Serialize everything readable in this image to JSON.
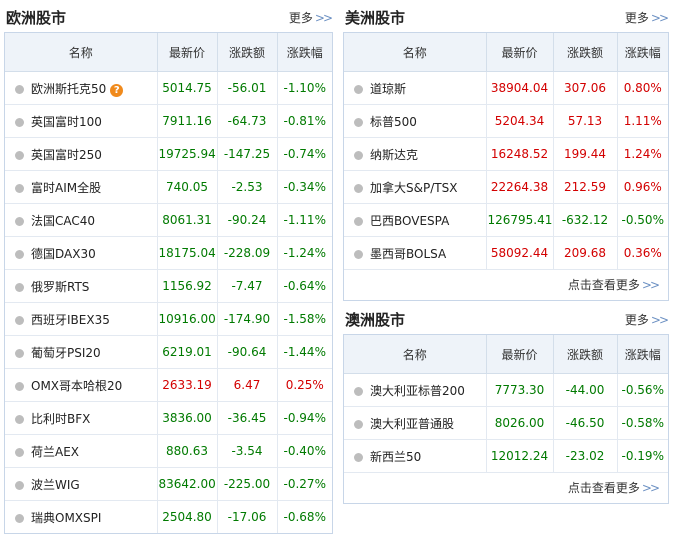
{
  "europe": {
    "title": "欧洲股市",
    "more": "更多",
    "headers": [
      "名称",
      "最新价",
      "涨跌额",
      "涨跌幅"
    ],
    "rows": [
      {
        "name": "欧洲斯托克50",
        "price": "5014.75",
        "change": "-56.01",
        "pct": "-1.10%",
        "dir": "down",
        "hint": "?"
      },
      {
        "name": "英国富时100",
        "price": "7911.16",
        "change": "-64.73",
        "pct": "-0.81%",
        "dir": "down"
      },
      {
        "name": "英国富时250",
        "price": "19725.94",
        "change": "-147.25",
        "pct": "-0.74%",
        "dir": "down"
      },
      {
        "name": "富时AIM全股",
        "price": "740.05",
        "change": "-2.53",
        "pct": "-0.34%",
        "dir": "down"
      },
      {
        "name": "法国CAC40",
        "price": "8061.31",
        "change": "-90.24",
        "pct": "-1.11%",
        "dir": "down"
      },
      {
        "name": "德国DAX30",
        "price": "18175.04",
        "change": "-228.09",
        "pct": "-1.24%",
        "dir": "down"
      },
      {
        "name": "俄罗斯RTS",
        "price": "1156.92",
        "change": "-7.47",
        "pct": "-0.64%",
        "dir": "down"
      },
      {
        "name": "西班牙IBEX35",
        "price": "10916.00",
        "change": "-174.90",
        "pct": "-1.58%",
        "dir": "down"
      },
      {
        "name": "葡萄牙PSI20",
        "price": "6219.01",
        "change": "-90.64",
        "pct": "-1.44%",
        "dir": "down"
      },
      {
        "name": "OMX哥本哈根20",
        "price": "2633.19",
        "change": "6.47",
        "pct": "0.25%",
        "dir": "up"
      },
      {
        "name": "比利时BFX",
        "price": "3836.00",
        "change": "-36.45",
        "pct": "-0.94%",
        "dir": "down"
      },
      {
        "name": "荷兰AEX",
        "price": "880.63",
        "change": "-3.54",
        "pct": "-0.40%",
        "dir": "down"
      },
      {
        "name": "波兰WIG",
        "price": "83642.00",
        "change": "-225.00",
        "pct": "-0.27%",
        "dir": "down"
      },
      {
        "name": "瑞典OMXSPI",
        "price": "2504.80",
        "change": "-17.06",
        "pct": "-0.68%",
        "dir": "down"
      }
    ]
  },
  "america": {
    "title": "美洲股市",
    "more": "更多",
    "headers": [
      "名称",
      "最新价",
      "涨跌额",
      "涨跌幅"
    ],
    "rows": [
      {
        "name": "道琼斯",
        "price": "38904.04",
        "change": "307.06",
        "pct": "0.80%",
        "dir": "up"
      },
      {
        "name": "标普500",
        "price": "5204.34",
        "change": "57.13",
        "pct": "1.11%",
        "dir": "up"
      },
      {
        "name": "纳斯达克",
        "price": "16248.52",
        "change": "199.44",
        "pct": "1.24%",
        "dir": "up"
      },
      {
        "name": "加拿大S&P/TSX",
        "price": "22264.38",
        "change": "212.59",
        "pct": "0.96%",
        "dir": "up"
      },
      {
        "name": "巴西BOVESPA",
        "price": "126795.41",
        "change": "-632.12",
        "pct": "-0.50%",
        "dir": "down"
      },
      {
        "name": "墨西哥BOLSA",
        "price": "58092.44",
        "change": "209.68",
        "pct": "0.36%",
        "dir": "up"
      }
    ],
    "footer": "点击查看更多"
  },
  "australia": {
    "title": "澳洲股市",
    "more": "更多",
    "headers": [
      "名称",
      "最新价",
      "涨跌额",
      "涨跌幅"
    ],
    "rows": [
      {
        "name": "澳大利亚标普200",
        "price": "7773.30",
        "change": "-44.00",
        "pct": "-0.56%",
        "dir": "down"
      },
      {
        "name": "澳大利亚普通股",
        "price": "8026.00",
        "change": "-46.50",
        "pct": "-0.58%",
        "dir": "down"
      },
      {
        "name": "新西兰50",
        "price": "12012.24",
        "change": "-23.02",
        "pct": "-0.19%",
        "dir": "down"
      }
    ],
    "footer": "点击查看更多"
  },
  "colors": {
    "up": "#d30000",
    "down": "#007a00",
    "header_bg": "#eef3f9",
    "border": "#c8d6e8",
    "hint": "#f08a1c"
  },
  "icons": {
    "row_bullet": "gray-dot-icon",
    "more_arrow": "double-chevron-right-icon",
    "hint": "question-mark-icon"
  }
}
